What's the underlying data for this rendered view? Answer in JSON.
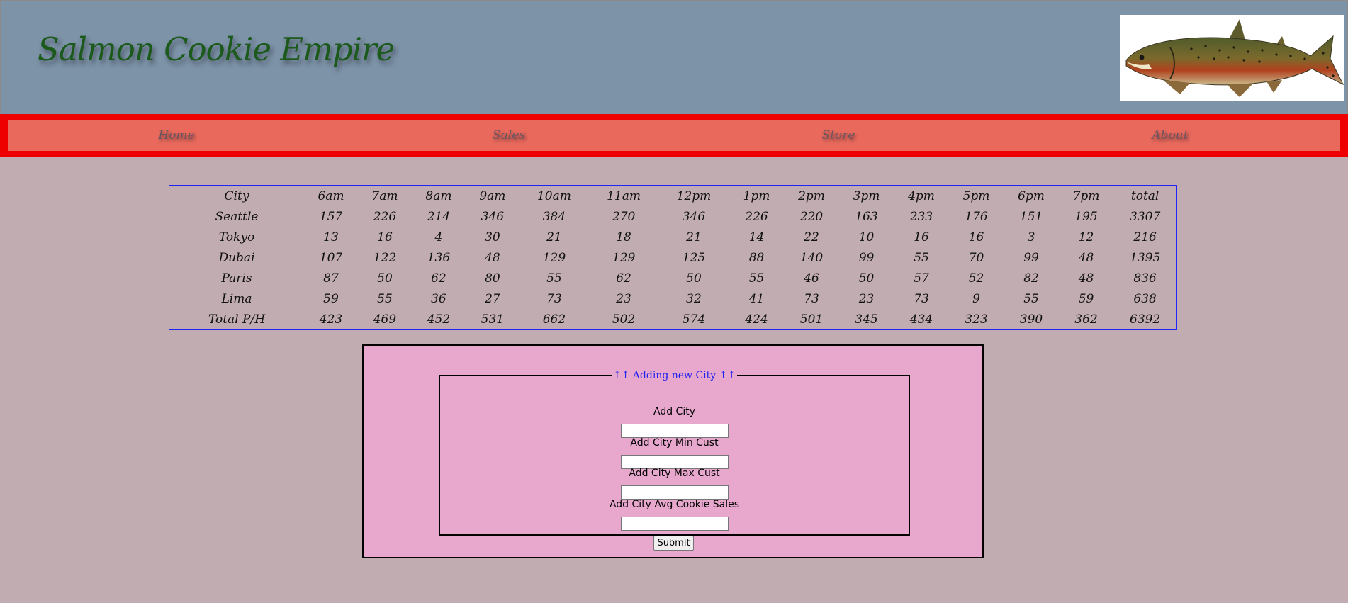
{
  "header": {
    "title": "Salmon Cookie Empire"
  },
  "nav": {
    "items": [
      {
        "label": "Home"
      },
      {
        "label": "Sales"
      },
      {
        "label": "Store"
      },
      {
        "label": "About"
      }
    ]
  },
  "sales_table": {
    "header": [
      "City",
      "6am",
      "7am",
      "8am",
      "9am",
      "10am",
      "11am",
      "12pm",
      "1pm",
      "2pm",
      "3pm",
      "4pm",
      "5pm",
      "6pm",
      "7pm",
      "total"
    ],
    "rows": [
      [
        "Seattle",
        "157",
        "226",
        "214",
        "346",
        "384",
        "270",
        "346",
        "226",
        "220",
        "163",
        "233",
        "176",
        "151",
        "195",
        "3307"
      ],
      [
        "Tokyo",
        "13",
        "16",
        "4",
        "30",
        "21",
        "18",
        "21",
        "14",
        "22",
        "10",
        "16",
        "16",
        "3",
        "12",
        "216"
      ],
      [
        "Dubai",
        "107",
        "122",
        "136",
        "48",
        "129",
        "129",
        "125",
        "88",
        "140",
        "99",
        "55",
        "70",
        "99",
        "48",
        "1395"
      ],
      [
        "Paris",
        "87",
        "50",
        "62",
        "80",
        "55",
        "62",
        "50",
        "55",
        "46",
        "50",
        "57",
        "52",
        "82",
        "48",
        "836"
      ],
      [
        "Lima",
        "59",
        "55",
        "36",
        "27",
        "73",
        "23",
        "32",
        "41",
        "73",
        "23",
        "73",
        "9",
        "55",
        "59",
        "638"
      ]
    ],
    "footer": [
      "Total P/H",
      "423",
      "469",
      "452",
      "531",
      "662",
      "502",
      "574",
      "424",
      "501",
      "345",
      "434",
      "323",
      "390",
      "362",
      "6392"
    ]
  },
  "form": {
    "legend": "↑↑ Adding new City ↑↑",
    "fields": [
      {
        "label": "Add City",
        "value": ""
      },
      {
        "label": "Add City Min Cust",
        "value": ""
      },
      {
        "label": "Add City Max Cust",
        "value": ""
      },
      {
        "label": "Add City Avg Cookie Sales",
        "value": ""
      }
    ],
    "submit_label": "Submit"
  },
  "colors": {
    "page_bg": "#c1adb1",
    "header_bg": "#7d93a8",
    "title": "#1c5a1c",
    "nav_border": "#ee0000",
    "nav_bg": "#e96a5c",
    "table_border": "#2222ff",
    "form_bg": "#e8a8cd",
    "legend": "#2222ee"
  }
}
